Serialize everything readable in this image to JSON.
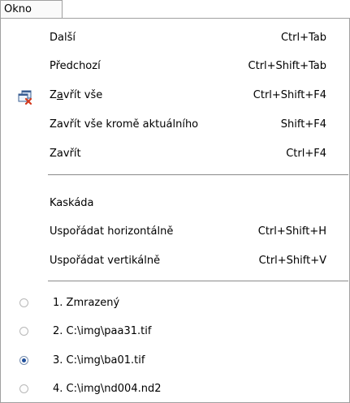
{
  "menubar": {
    "title": "Okno"
  },
  "menu": {
    "group1": [
      {
        "label": "Další",
        "shortcut": "Ctrl+Tab"
      },
      {
        "label": "Předchozí",
        "shortcut": "Ctrl+Shift+Tab"
      },
      {
        "label_pre": "Z",
        "label_u": "a",
        "label_post": "vřít vše",
        "shortcut": "Ctrl+Shift+F4",
        "icon": "close-all-windows-icon"
      },
      {
        "label": "Zavřít vše kromě aktuálního",
        "shortcut": "Shift+F4"
      },
      {
        "label": "Zavřít",
        "shortcut": "Ctrl+F4"
      }
    ],
    "group2": [
      {
        "label": "Kaskáda",
        "shortcut": ""
      },
      {
        "label": "Uspořádat horizontálně",
        "shortcut": "Ctrl+Shift+H"
      },
      {
        "label": "Uspořádat vertikálně",
        "shortcut": "Ctrl+Shift+V"
      }
    ],
    "windows": [
      {
        "label": "1.  Zmrazený",
        "selected": false
      },
      {
        "label": "2.  C:\\img\\paa31.tif",
        "selected": false
      },
      {
        "label": "3.  C:\\img\\ba01.tif",
        "selected": true
      },
      {
        "label": "4.  C:\\img\\nd004.nd2",
        "selected": false
      }
    ]
  },
  "colors": {
    "border": "#a0a0a0",
    "separator": "#8a8a8a",
    "radio_dot": "#1f4f9c"
  }
}
